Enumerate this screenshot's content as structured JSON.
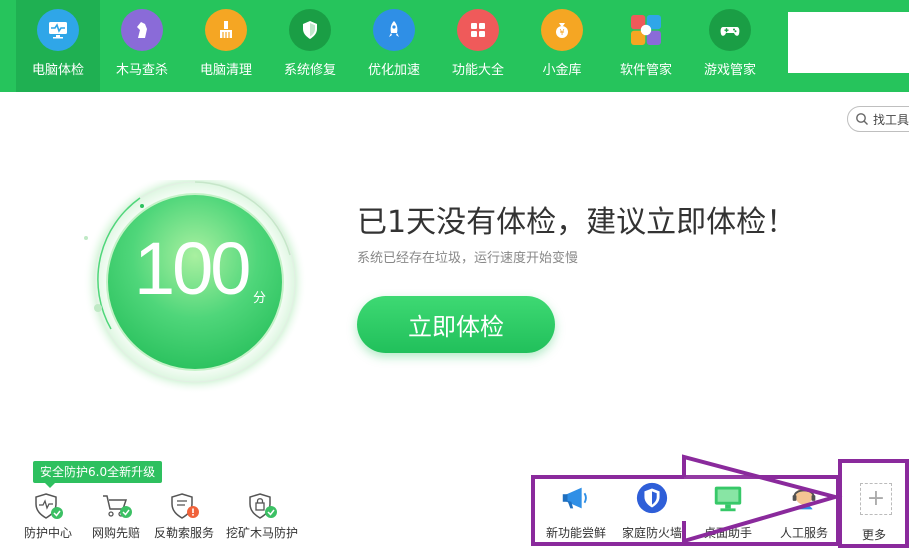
{
  "nav": {
    "items": [
      {
        "label": "电脑体检",
        "icon": "monitor-pulse-icon",
        "color": "#2fa6e8",
        "active": true
      },
      {
        "label": "木马查杀",
        "icon": "horse-icon",
        "color": "#8a6bd8"
      },
      {
        "label": "电脑清理",
        "icon": "broom-icon",
        "color": "#f5a623"
      },
      {
        "label": "系统修复",
        "icon": "shield-icon",
        "color": "#1a9e45"
      },
      {
        "label": "优化加速",
        "icon": "rocket-icon",
        "color": "#2f8fe6"
      },
      {
        "label": "功能大全",
        "icon": "grid-icon",
        "color": "#ef5a5a"
      },
      {
        "label": "小金库",
        "icon": "coin-bag-icon",
        "color": "#f5a623"
      },
      {
        "label": "软件管家",
        "icon": "flower-icon",
        "color": "#ffffff"
      },
      {
        "label": "游戏管家",
        "icon": "gamepad-icon",
        "color": "#1a9e45"
      }
    ]
  },
  "search": {
    "label": "找工具"
  },
  "score": {
    "value": "100",
    "unit": "分"
  },
  "headline": "已1天没有体检，建议立即体检！",
  "subline": "系统已经存在垃圾，运行速度开始变慢",
  "check_button": "立即体检",
  "badge": "安全防护6.0全新升级",
  "left_tools": [
    {
      "label": "防护中心",
      "icon": "shield-pulse-icon"
    },
    {
      "label": "网购先赔",
      "icon": "cart-icon"
    },
    {
      "label": "反勒索服务",
      "icon": "shield-alert-icon"
    },
    {
      "label": "挖矿木马防护",
      "icon": "shield-lock-icon"
    }
  ],
  "right_tools": [
    {
      "label": "新功能尝鲜",
      "icon": "megaphone-icon"
    },
    {
      "label": "家庭防火墙",
      "icon": "firewall-shield-icon"
    },
    {
      "label": "桌面助手",
      "icon": "desktop-icon"
    },
    {
      "label": "人工服务",
      "icon": "service-icon"
    }
  ],
  "more": {
    "label": "更多",
    "icon": "plus-icon"
  },
  "colors": {
    "brand": "#26c45c",
    "annotation": "#8a2a9c"
  }
}
